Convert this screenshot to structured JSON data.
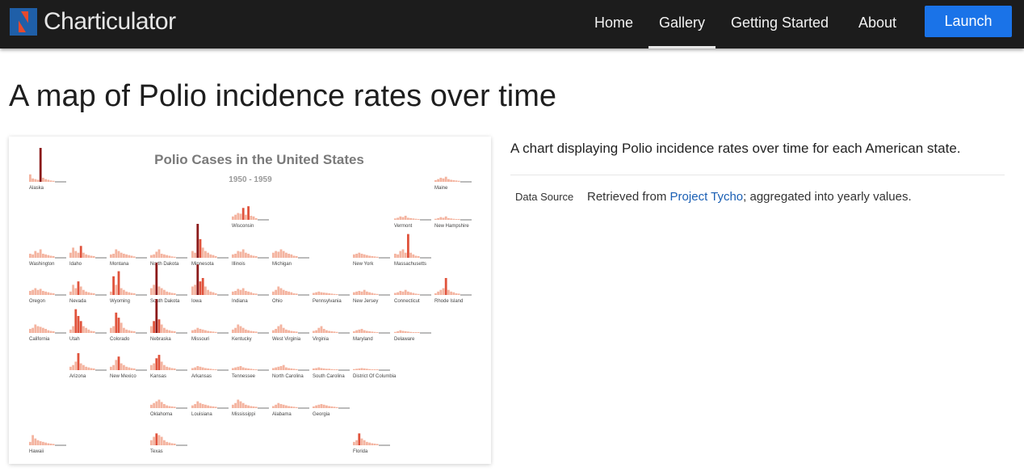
{
  "brand": {
    "name": "Charticulator"
  },
  "nav": {
    "home": "Home",
    "gallery": "Gallery",
    "getting_started": "Getting Started",
    "about": "About",
    "launch": "Launch"
  },
  "page": {
    "title": "A map of Polio incidence rates over time",
    "description": "A chart displaying Polio incidence rates over time for each American state.",
    "data_source_label": "Data Source",
    "data_source_prefix": "Retrieved from ",
    "data_source_link": "Project Tycho",
    "data_source_suffix": "; aggregated into yearly values."
  },
  "colors": {
    "navbar": "#1c1c1c",
    "launch": "#1a73e8",
    "link": "#1a5fb4",
    "bar_high": "#8b1a1a",
    "bar_mid": "#e0533c",
    "bar_low": "#f4b4a0"
  },
  "chart_data": {
    "type": "bar",
    "title": "Polio Cases in the United States",
    "subtitle": "1950 - 1959",
    "states": [
      {
        "name": "Alaska",
        "values": [
          0.22,
          0.1,
          0.08,
          0.06,
          1.0,
          0.12,
          0.08,
          0.06,
          0.04,
          0.03
        ]
      },
      {
        "name": "Maine",
        "values": [
          0.05,
          0.08,
          0.12,
          0.1,
          0.15,
          0.08,
          0.06,
          0.05,
          0.04,
          0.03
        ]
      },
      {
        "name": "Wisconsin",
        "values": [
          0.1,
          0.15,
          0.2,
          0.18,
          0.35,
          0.15,
          0.4,
          0.12,
          0.1,
          0.05
        ]
      },
      {
        "name": "Vermont",
        "values": [
          0.04,
          0.06,
          0.1,
          0.08,
          0.12,
          0.06,
          0.05,
          0.04,
          0.03,
          0.02
        ]
      },
      {
        "name": "New Hampshire",
        "values": [
          0.03,
          0.05,
          0.08,
          0.06,
          0.1,
          0.05,
          0.04,
          0.03,
          0.02,
          0.02
        ]
      },
      {
        "name": "Washington",
        "values": [
          0.12,
          0.1,
          0.2,
          0.15,
          0.25,
          0.12,
          0.1,
          0.08,
          0.06,
          0.05
        ]
      },
      {
        "name": "Idaho",
        "values": [
          0.15,
          0.3,
          0.2,
          0.15,
          0.35,
          0.15,
          0.1,
          0.08,
          0.06,
          0.05
        ]
      },
      {
        "name": "Montana",
        "values": [
          0.1,
          0.12,
          0.25,
          0.2,
          0.15,
          0.12,
          0.1,
          0.08,
          0.06,
          0.04
        ]
      },
      {
        "name": "North Dakota",
        "values": [
          0.08,
          0.1,
          0.18,
          0.25,
          0.12,
          0.1,
          0.08,
          0.06,
          0.04,
          0.03
        ]
      },
      {
        "name": "Minnesota",
        "values": [
          0.2,
          0.15,
          1.0,
          0.55,
          0.3,
          0.2,
          0.15,
          0.1,
          0.08,
          0.05
        ]
      },
      {
        "name": "Illinois",
        "values": [
          0.1,
          0.12,
          0.2,
          0.18,
          0.25,
          0.15,
          0.12,
          0.08,
          0.06,
          0.05
        ]
      },
      {
        "name": "Michigan",
        "values": [
          0.15,
          0.2,
          0.18,
          0.25,
          0.2,
          0.15,
          0.12,
          0.1,
          0.06,
          0.05
        ]
      },
      {
        "name": "New York",
        "values": [
          0.1,
          0.12,
          0.15,
          0.12,
          0.1,
          0.08,
          0.06,
          0.05,
          0.04,
          0.03
        ]
      },
      {
        "name": "Massachusetts",
        "values": [
          0.12,
          0.1,
          0.2,
          0.25,
          0.15,
          0.7,
          0.15,
          0.1,
          0.06,
          0.05
        ]
      },
      {
        "name": "Oregon",
        "values": [
          0.12,
          0.15,
          0.2,
          0.15,
          0.18,
          0.12,
          0.1,
          0.08,
          0.06,
          0.05
        ]
      },
      {
        "name": "Nevada",
        "values": [
          0.1,
          0.3,
          0.2,
          0.4,
          0.25,
          0.15,
          0.1,
          0.08,
          0.06,
          0.05
        ]
      },
      {
        "name": "Wyoming",
        "values": [
          0.1,
          0.55,
          0.3,
          0.7,
          0.2,
          0.15,
          0.1,
          0.08,
          0.06,
          0.05
        ]
      },
      {
        "name": "South Dakota",
        "values": [
          0.2,
          0.3,
          0.95,
          0.25,
          0.2,
          0.15,
          0.1,
          0.08,
          0.06,
          0.05
        ]
      },
      {
        "name": "Iowa",
        "values": [
          0.25,
          0.3,
          0.9,
          0.4,
          0.5,
          0.25,
          0.15,
          0.1,
          0.08,
          0.05
        ]
      },
      {
        "name": "Indiana",
        "values": [
          0.1,
          0.12,
          0.18,
          0.15,
          0.2,
          0.12,
          0.1,
          0.08,
          0.05,
          0.04
        ]
      },
      {
        "name": "Ohio",
        "values": [
          0.1,
          0.15,
          0.25,
          0.2,
          0.15,
          0.12,
          0.1,
          0.08,
          0.05,
          0.04
        ]
      },
      {
        "name": "Pennsylvania",
        "values": [
          0.06,
          0.08,
          0.1,
          0.08,
          0.07,
          0.06,
          0.05,
          0.04,
          0.03,
          0.02
        ]
      },
      {
        "name": "New Jersey",
        "values": [
          0.08,
          0.1,
          0.12,
          0.1,
          0.15,
          0.1,
          0.08,
          0.06,
          0.04,
          0.03
        ]
      },
      {
        "name": "Connecticut",
        "values": [
          0.06,
          0.08,
          0.12,
          0.1,
          0.15,
          0.1,
          0.08,
          0.06,
          0.04,
          0.03
        ]
      },
      {
        "name": "Rhode Island",
        "values": [
          0.05,
          0.1,
          0.15,
          0.2,
          0.5,
          0.15,
          0.1,
          0.08,
          0.05,
          0.04
        ]
      },
      {
        "name": "California",
        "values": [
          0.12,
          0.15,
          0.25,
          0.2,
          0.18,
          0.15,
          0.12,
          0.08,
          0.06,
          0.05
        ]
      },
      {
        "name": "Utah",
        "values": [
          0.1,
          0.2,
          0.7,
          0.5,
          0.35,
          0.2,
          0.15,
          0.1,
          0.06,
          0.05
        ]
      },
      {
        "name": "Colorado",
        "values": [
          0.15,
          0.2,
          0.6,
          0.45,
          0.3,
          0.15,
          0.1,
          0.08,
          0.06,
          0.05
        ]
      },
      {
        "name": "Nebraska",
        "values": [
          0.2,
          0.35,
          1.0,
          0.4,
          0.25,
          0.15,
          0.1,
          0.08,
          0.06,
          0.05
        ]
      },
      {
        "name": "Missouri",
        "values": [
          0.08,
          0.1,
          0.15,
          0.12,
          0.1,
          0.08,
          0.06,
          0.05,
          0.04,
          0.03
        ]
      },
      {
        "name": "Kentucky",
        "values": [
          0.1,
          0.15,
          0.25,
          0.2,
          0.15,
          0.1,
          0.08,
          0.06,
          0.05,
          0.04
        ]
      },
      {
        "name": "West Virginia",
        "values": [
          0.08,
          0.12,
          0.2,
          0.25,
          0.15,
          0.1,
          0.08,
          0.06,
          0.05,
          0.04
        ]
      },
      {
        "name": "Virginia",
        "values": [
          0.06,
          0.08,
          0.15,
          0.2,
          0.12,
          0.08,
          0.06,
          0.05,
          0.04,
          0.03
        ]
      },
      {
        "name": "Maryland",
        "values": [
          0.05,
          0.08,
          0.1,
          0.12,
          0.08,
          0.06,
          0.05,
          0.04,
          0.03,
          0.02
        ]
      },
      {
        "name": "Delaware",
        "values": [
          0.03,
          0.05,
          0.08,
          0.06,
          0.05,
          0.04,
          0.03,
          0.02,
          0.02,
          0.01
        ]
      },
      {
        "name": "Arizona",
        "values": [
          0.1,
          0.15,
          0.25,
          0.5,
          0.2,
          0.15,
          0.1,
          0.08,
          0.06,
          0.05
        ]
      },
      {
        "name": "New Mexico",
        "values": [
          0.1,
          0.15,
          0.3,
          0.4,
          0.2,
          0.15,
          0.1,
          0.08,
          0.06,
          0.05
        ]
      },
      {
        "name": "Kansas",
        "values": [
          0.15,
          0.2,
          0.35,
          0.45,
          0.25,
          0.15,
          0.1,
          0.08,
          0.06,
          0.05
        ]
      },
      {
        "name": "Arkansas",
        "values": [
          0.06,
          0.08,
          0.12,
          0.1,
          0.08,
          0.06,
          0.05,
          0.04,
          0.03,
          0.02
        ]
      },
      {
        "name": "Tennessee",
        "values": [
          0.06,
          0.08,
          0.1,
          0.12,
          0.08,
          0.06,
          0.05,
          0.04,
          0.03,
          0.02
        ]
      },
      {
        "name": "North Carolina",
        "values": [
          0.06,
          0.08,
          0.1,
          0.12,
          0.15,
          0.08,
          0.06,
          0.05,
          0.04,
          0.03
        ]
      },
      {
        "name": "South Carolina",
        "values": [
          0.05,
          0.06,
          0.08,
          0.06,
          0.05,
          0.04,
          0.04,
          0.03,
          0.02,
          0.02
        ]
      },
      {
        "name": "District Of Columbia",
        "values": [
          0.03,
          0.04,
          0.05,
          0.06,
          0.05,
          0.04,
          0.03,
          0.02,
          0.02,
          0.01
        ]
      },
      {
        "name": "Oklahoma",
        "values": [
          0.1,
          0.15,
          0.2,
          0.25,
          0.18,
          0.12,
          0.08,
          0.06,
          0.05,
          0.04
        ]
      },
      {
        "name": "Louisiana",
        "values": [
          0.08,
          0.12,
          0.2,
          0.15,
          0.12,
          0.1,
          0.08,
          0.06,
          0.05,
          0.04
        ]
      },
      {
        "name": "Mississippi",
        "values": [
          0.1,
          0.15,
          0.25,
          0.2,
          0.15,
          0.1,
          0.08,
          0.06,
          0.05,
          0.04
        ]
      },
      {
        "name": "Alabama",
        "values": [
          0.06,
          0.1,
          0.15,
          0.12,
          0.1,
          0.08,
          0.06,
          0.05,
          0.04,
          0.03
        ]
      },
      {
        "name": "Georgia",
        "values": [
          0.05,
          0.08,
          0.1,
          0.12,
          0.1,
          0.08,
          0.06,
          0.05,
          0.04,
          0.03
        ]
      },
      {
        "name": "Hawaii",
        "values": [
          0.1,
          0.3,
          0.2,
          0.15,
          0.12,
          0.1,
          0.08,
          0.06,
          0.05,
          0.04
        ]
      },
      {
        "name": "Texas",
        "values": [
          0.15,
          0.25,
          0.35,
          0.3,
          0.25,
          0.15,
          0.1,
          0.08,
          0.06,
          0.05
        ]
      },
      {
        "name": "Florida",
        "values": [
          0.1,
          0.15,
          0.35,
          0.2,
          0.15,
          0.1,
          0.08,
          0.06,
          0.05,
          0.04
        ]
      }
    ]
  }
}
